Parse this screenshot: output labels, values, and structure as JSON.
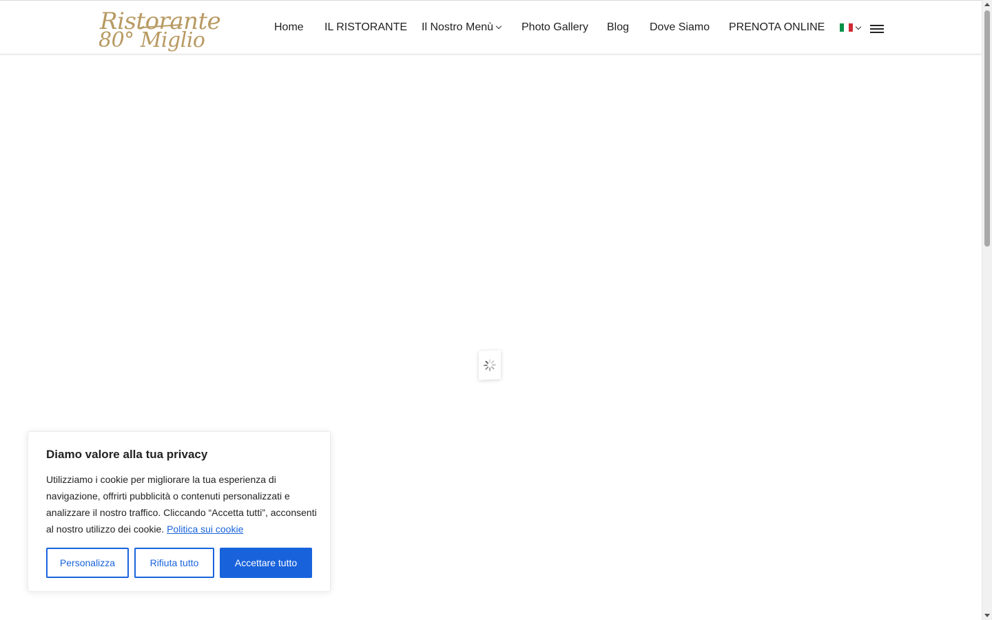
{
  "header": {
    "logo": {
      "line1": "Ristorante",
      "line2": "80° Miglio",
      "color": "#b89a62"
    },
    "nav": [
      {
        "label": "Home"
      },
      {
        "label": "IL RISTORANTE"
      },
      {
        "label": "Il Nostro Menù",
        "has_dropdown": true
      },
      {
        "label": "Photo Gallery"
      },
      {
        "label": "Blog"
      },
      {
        "label": "Dove Siamo"
      },
      {
        "label": "PRENOTA ONLINE"
      }
    ],
    "language": {
      "flag": "italy-flag-icon",
      "colors": [
        "#009246",
        "#ffffff",
        "#ce2b37"
      ]
    },
    "menu_icon": "hamburger-icon"
  },
  "loader": {
    "icon": "spinner-icon"
  },
  "cookie_banner": {
    "title": "Diamo valore alla tua privacy",
    "text": "Utilizziamo i cookie per migliorare la tua esperienza di navigazione, offrirti pubblicità o contenuti personalizzati e analizzare il nostro traffico. Cliccando “Accetta tutti”, acconsenti al nostro utilizzo dei cookie.",
    "policy_link": "Politica sui cookie",
    "buttons": {
      "customize": "Personalizza",
      "reject": "Rifiuta tutto",
      "accept": "Accettare tutto"
    },
    "accent_color": "#1863dc"
  }
}
